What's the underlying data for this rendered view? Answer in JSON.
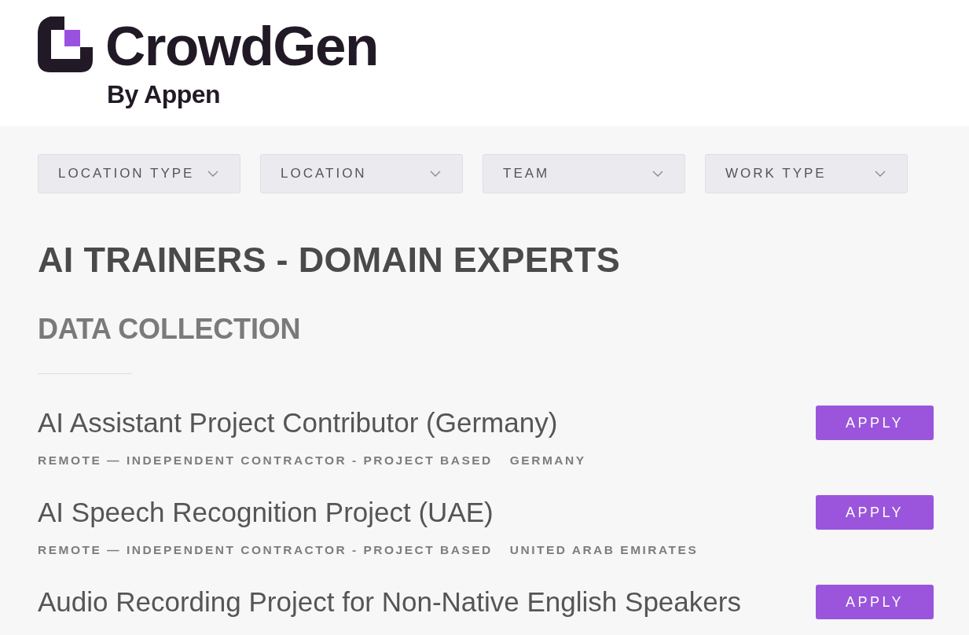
{
  "header": {
    "logo": {
      "wordmark": "CrowdGen",
      "tagline": "By Appen"
    }
  },
  "filters": [
    {
      "label": "LOCATION TYPE"
    },
    {
      "label": "LOCATION"
    },
    {
      "label": "TEAM"
    },
    {
      "label": "WORK TYPE"
    }
  ],
  "department": "AI TRAINERS - DOMAIN EXPERTS",
  "team": "DATA COLLECTION",
  "jobs": [
    {
      "title": "AI Assistant Project Contributor (Germany)",
      "commitment": "REMOTE — INDEPENDENT CONTRACTOR - PROJECT BASED",
      "location": "GERMANY",
      "button": "APPLY"
    },
    {
      "title": "AI Speech Recognition Project (UAE)",
      "commitment": "REMOTE — INDEPENDENT CONTRACTOR - PROJECT BASED",
      "location": "UNITED ARAB EMIRATES",
      "button": "APPLY"
    },
    {
      "title": "Audio Recording Project for Non-Native English Speakers",
      "button": "APPLY"
    }
  ]
}
